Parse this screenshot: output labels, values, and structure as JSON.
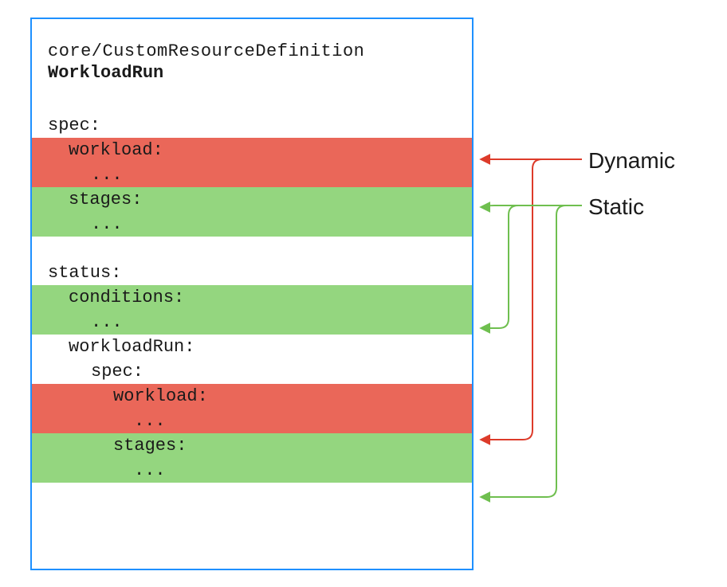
{
  "header": {
    "crd_label": "core/CustomResourceDefinition",
    "crd_name": "WorkloadRun"
  },
  "yaml": {
    "spec_key": "spec:",
    "workload_key": "workload:",
    "ellipsis": "...",
    "stages_key": "stages:",
    "status_key": "status:",
    "conditions_key": "conditions:",
    "workloadRun_key": "workloadRun:",
    "nested_spec_key": "spec:",
    "nested_workload_key": "workload:",
    "nested_stages_key": "stages:"
  },
  "labels": {
    "dynamic": "Dynamic",
    "static": "Static"
  },
  "colors": {
    "border": "#1e90ff",
    "red": "#ea6759",
    "green": "#94d67f",
    "arrow_red": "#dd3b2a",
    "arrow_green": "#6fbf4f"
  }
}
